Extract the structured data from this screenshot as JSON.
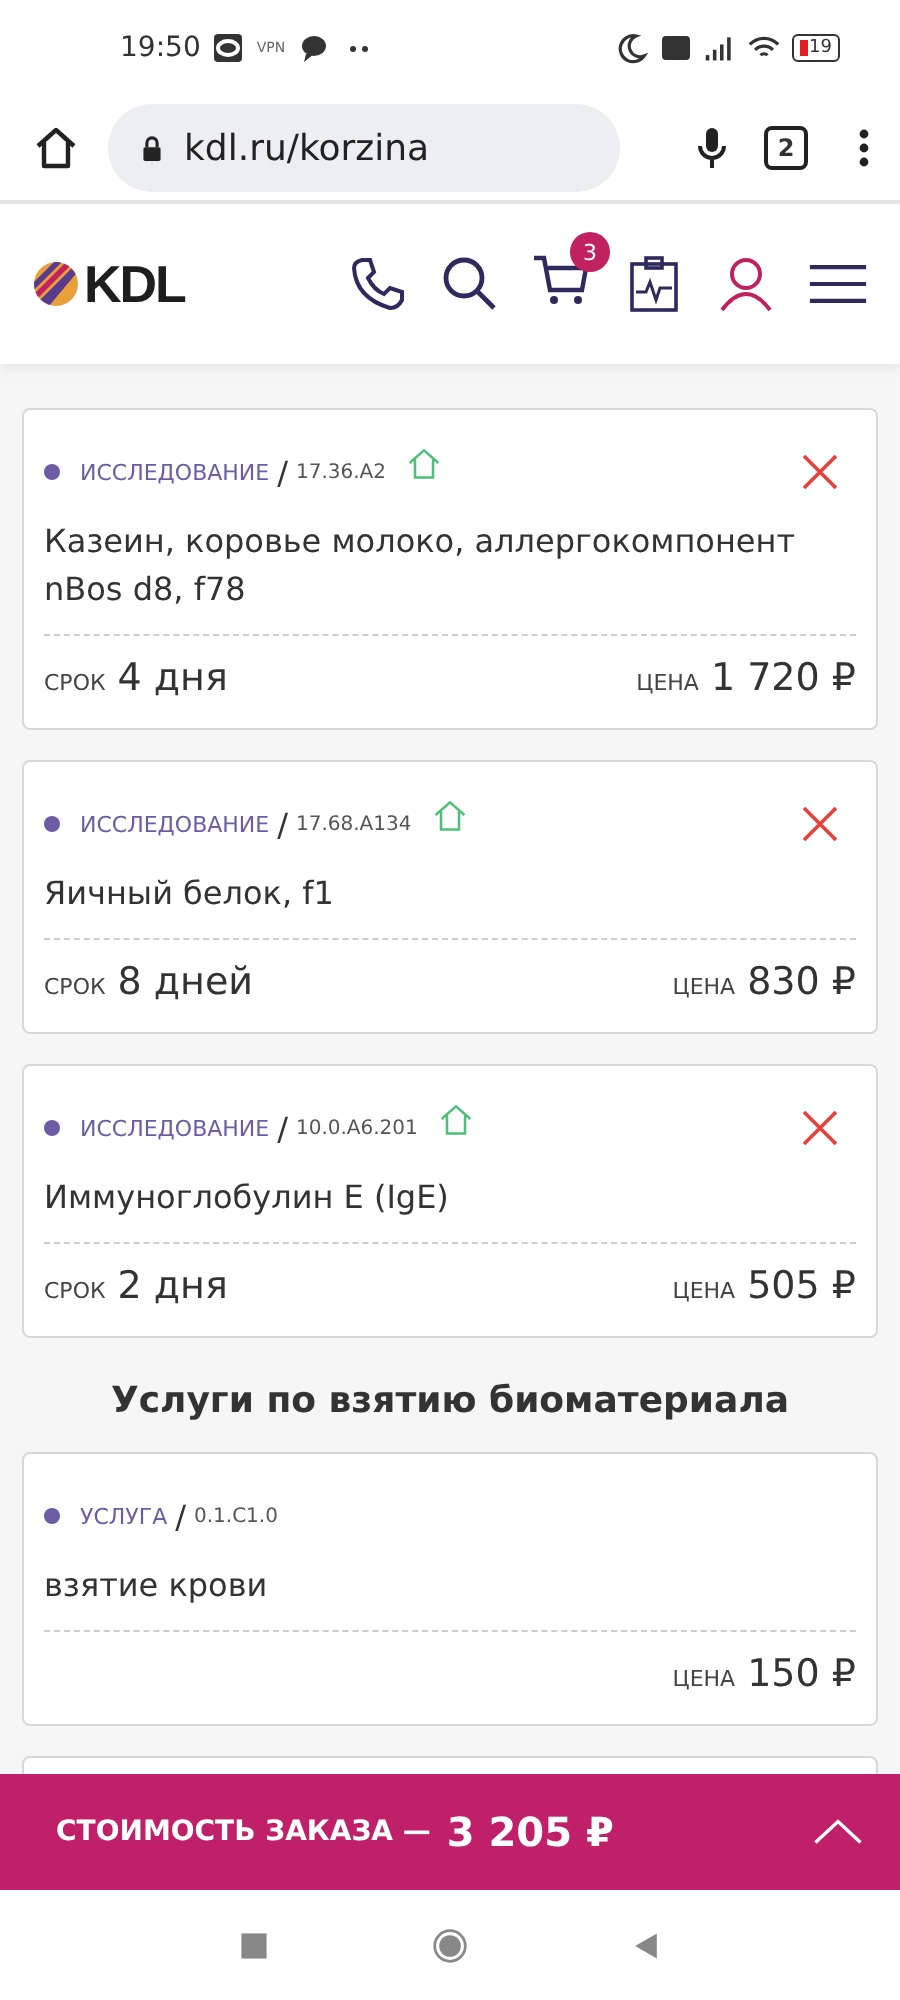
{
  "status_bar": {
    "time": "19:50",
    "vpn": "VPN",
    "battery": "19"
  },
  "browser": {
    "url": "kdl.ru/korzina",
    "tabs_count": "2"
  },
  "header": {
    "logo": "KDL",
    "cart_count": "3"
  },
  "sections": [
    {
      "items": [
        {
          "kind": "study",
          "type": "ИССЛЕДОВАНИЕ",
          "separator": "/",
          "code": "17.36.A2",
          "home_visit": true,
          "removable": true,
          "name": "Казеин, коровье молоко, аллергокомпонент nBos d8, f78",
          "term_label": "СРОК",
          "term": "4 дня",
          "price_label": "ЦЕНА",
          "price": "1 720 ₽"
        },
        {
          "kind": "study",
          "type": "ИССЛЕДОВАНИЕ",
          "separator": "/",
          "code": "17.68.A134",
          "home_visit": true,
          "removable": true,
          "name": "Яичный белок, f1",
          "term_label": "СРОК",
          "term": "8 дней",
          "price_label": "ЦЕНА",
          "price": "830 ₽"
        },
        {
          "kind": "study",
          "type": "ИССЛЕДОВАНИЕ",
          "separator": "/",
          "code": "10.0.A6.201",
          "home_visit": true,
          "removable": true,
          "name": "Иммуноглобулин E (IgE)",
          "term_label": "СРОК",
          "term": "2 дня",
          "price_label": "ЦЕНА",
          "price": "505 ₽"
        }
      ]
    },
    {
      "title": "Услуги по взятию биоматериала",
      "items": [
        {
          "kind": "service",
          "type": "УСЛУГА",
          "separator": "/",
          "code": "0.1.C1.0",
          "home_visit": false,
          "removable": false,
          "name": "взятие крови",
          "price_label": "ЦЕНА",
          "price": "150 ₽"
        }
      ]
    }
  ],
  "total_bar": {
    "label": "СТОИМОСТЬ ЗАКАЗА —",
    "amount": "3 205 ₽",
    "expanded": false
  }
}
